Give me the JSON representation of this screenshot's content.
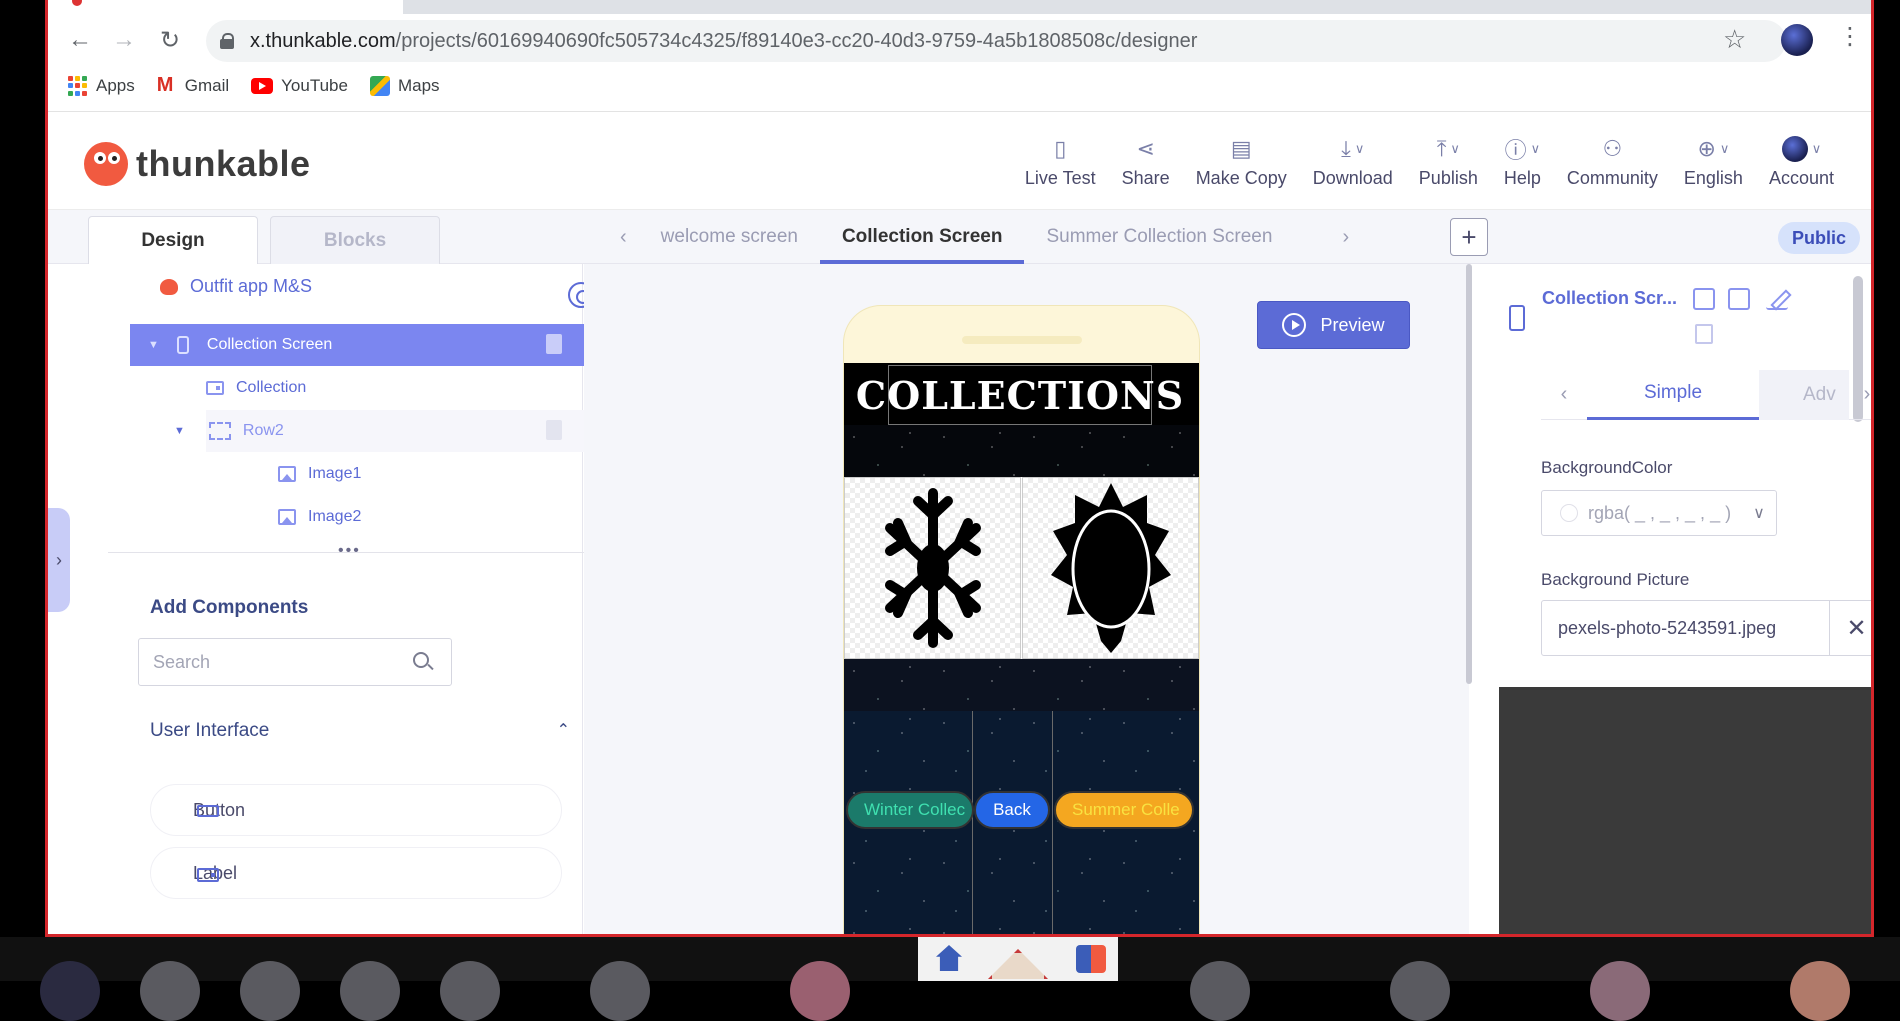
{
  "browser": {
    "url_host": "x.thunkable.com",
    "url_path": "/projects/60169940690fc505734c4325/f89140e3-cc20-40d3-9759-4a5b1808508c/designer",
    "bookmarks": [
      {
        "label": "Apps",
        "icon": "apps-grid-icon"
      },
      {
        "label": "Gmail",
        "icon": "gmail-icon"
      },
      {
        "label": "YouTube",
        "icon": "youtube-icon"
      },
      {
        "label": "Maps",
        "icon": "maps-icon"
      }
    ]
  },
  "header": {
    "logo_text": "thunkable",
    "actions": [
      {
        "label": "Live Test",
        "icon": "▯"
      },
      {
        "label": "Share",
        "icon": "⋖"
      },
      {
        "label": "Make Copy",
        "icon": "▤"
      },
      {
        "label": "Download",
        "icon": "⤓"
      },
      {
        "label": "Publish",
        "icon": "⤒"
      },
      {
        "label": "Help",
        "icon": "ⓘ"
      },
      {
        "label": "Community",
        "icon": "⚇"
      },
      {
        "label": "English",
        "icon": "⊕"
      },
      {
        "label": "Account",
        "icon": ""
      }
    ]
  },
  "tabs": {
    "design": "Design",
    "blocks": "Blocks",
    "screens": [
      "welcome screen",
      "Collection Screen",
      "Summer Collection Screen"
    ],
    "add": "+",
    "public": "Public"
  },
  "tree": {
    "project": "Outfit app M&S",
    "screen": "Collection Screen",
    "collection": "Collection",
    "row2": "Row2",
    "image1": "Image1",
    "image2": "Image2"
  },
  "components": {
    "title": "Add Components",
    "search_placeholder": "Search",
    "category": "User Interface",
    "items": [
      "Button",
      "Label"
    ]
  },
  "canvas": {
    "preview": "Preview",
    "phone_title": "COLLECTIONS",
    "buttons": {
      "winter": "Winter Collec",
      "back": "Back",
      "summer": "Summer Colle"
    }
  },
  "properties": {
    "title": "Collection Scr...",
    "tab_simple": "Simple",
    "tab_advanced": "Adv",
    "bg_color_label": "BackgroundColor",
    "bg_color_value": "rgba( _ , _ , _ , _ )",
    "bg_picture_label": "Background Picture",
    "bg_picture_value": "pexels-photo-5243591.jpeg",
    "clear": "✕"
  }
}
